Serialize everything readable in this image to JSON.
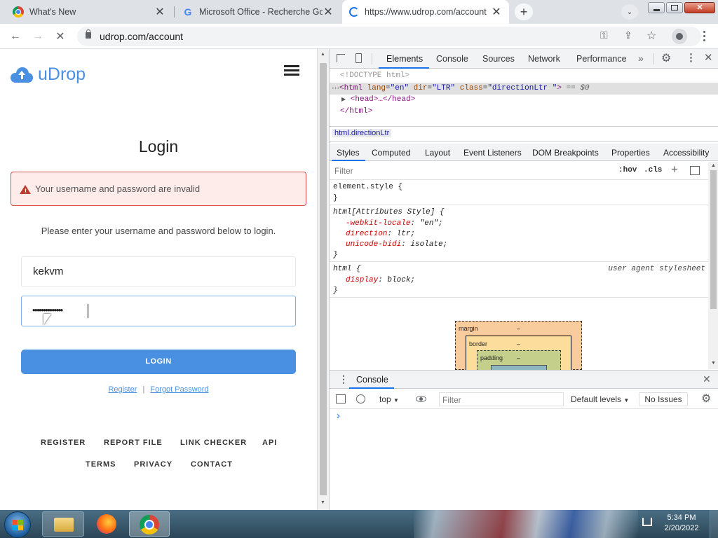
{
  "tabs": [
    {
      "title": "What's New",
      "icon": "chrome-icon"
    },
    {
      "title": "Microsoft Office - Recherche Goo",
      "icon": "google-icon"
    },
    {
      "title": "https://www.udrop.com/account",
      "icon": "loading-spinner-icon"
    }
  ],
  "address": {
    "url": "udrop.com/account"
  },
  "site": {
    "brand": "uDrop",
    "login_title": "Login",
    "error": "Your username and password are invalid",
    "instructions": "Please enter your username and password below to login.",
    "username_value": "kekvm",
    "password_value": "••••••••••••••",
    "login_button": "LOGIN",
    "register_link": "Register",
    "link_sep": "|",
    "forgot_link": "Forgot Password",
    "footer_row1": [
      "REGISTER",
      "REPORT FILE",
      "LINK CHECKER",
      "API"
    ],
    "footer_row2": [
      "TERMS",
      "PRIVACY",
      "CONTACT"
    ],
    "accent": "#4a90e2"
  },
  "devtools": {
    "tabs": [
      "Elements",
      "Console",
      "Sources",
      "Network",
      "Performance"
    ],
    "more": "»",
    "dom": {
      "doctype": "<!DOCTYPE html>",
      "html_open_tag": "html",
      "html_attrs": [
        {
          "name": "lang",
          "value": "\"en\""
        },
        {
          "name": "dir",
          "value": "\"LTR\""
        },
        {
          "name": "class",
          "value": "\"directionLtr \""
        }
      ],
      "html_open_close": ">",
      "eq": "== $0",
      "head": "<head>…</head>",
      "html_close": "</html>"
    },
    "breadcrumb": "html.directionLtr",
    "styles_tabs": [
      "Styles",
      "Computed",
      "Layout",
      "Event Listeners",
      "DOM Breakpoints",
      "Properties",
      "Accessibility"
    ],
    "filter_placeholder": "Filter",
    "hov": ":hov",
    "cls": ".cls",
    "plus": "+",
    "rule1": {
      "selector": "element.style {",
      "close": "}"
    },
    "rule2": {
      "selector": "html[Attributes Style] {",
      "props": [
        {
          "name": "-webkit-locale",
          "value": "\"en\";"
        },
        {
          "name": "direction",
          "value": "ltr;"
        },
        {
          "name": "unicode-bidi",
          "value": "isolate;"
        }
      ],
      "close": "}"
    },
    "rule3": {
      "selector": "html {",
      "source": "user agent stylesheet",
      "props": [
        {
          "name": "display",
          "value": "block;"
        }
      ],
      "close": "}"
    },
    "boxmodel": {
      "margin": "margin",
      "border": "border",
      "padding": "padding",
      "dash": "–"
    },
    "console": {
      "title": "Console",
      "context": "top",
      "filter_placeholder": "Filter",
      "levels": "Default levels",
      "issues": "No Issues",
      "prompt": "›"
    }
  },
  "taskbar": {
    "time": "5:34 PM",
    "date": "2/20/2022"
  }
}
